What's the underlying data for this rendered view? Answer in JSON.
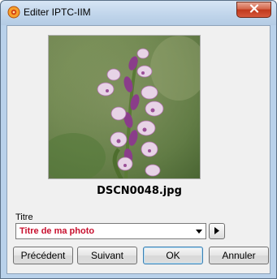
{
  "window": {
    "title": "Editer IPTC-IIM",
    "close_label": "X"
  },
  "photo": {
    "filename": "DSCN0048.jpg",
    "subject": "orchid-flower-photo"
  },
  "form": {
    "title_label": "Titre",
    "title_value": "Titre de ma photo"
  },
  "buttons": {
    "previous": "Précédent",
    "next": "Suivant",
    "ok": "OK",
    "cancel": "Annuler"
  },
  "colors": {
    "title_value": "#c8102e",
    "titlebar": "#c3d7ec",
    "close_button": "#c0391d"
  },
  "icons": {
    "app": "app-icon",
    "close": "close-icon",
    "dropdown": "chevron-down-icon",
    "play": "play-icon"
  }
}
